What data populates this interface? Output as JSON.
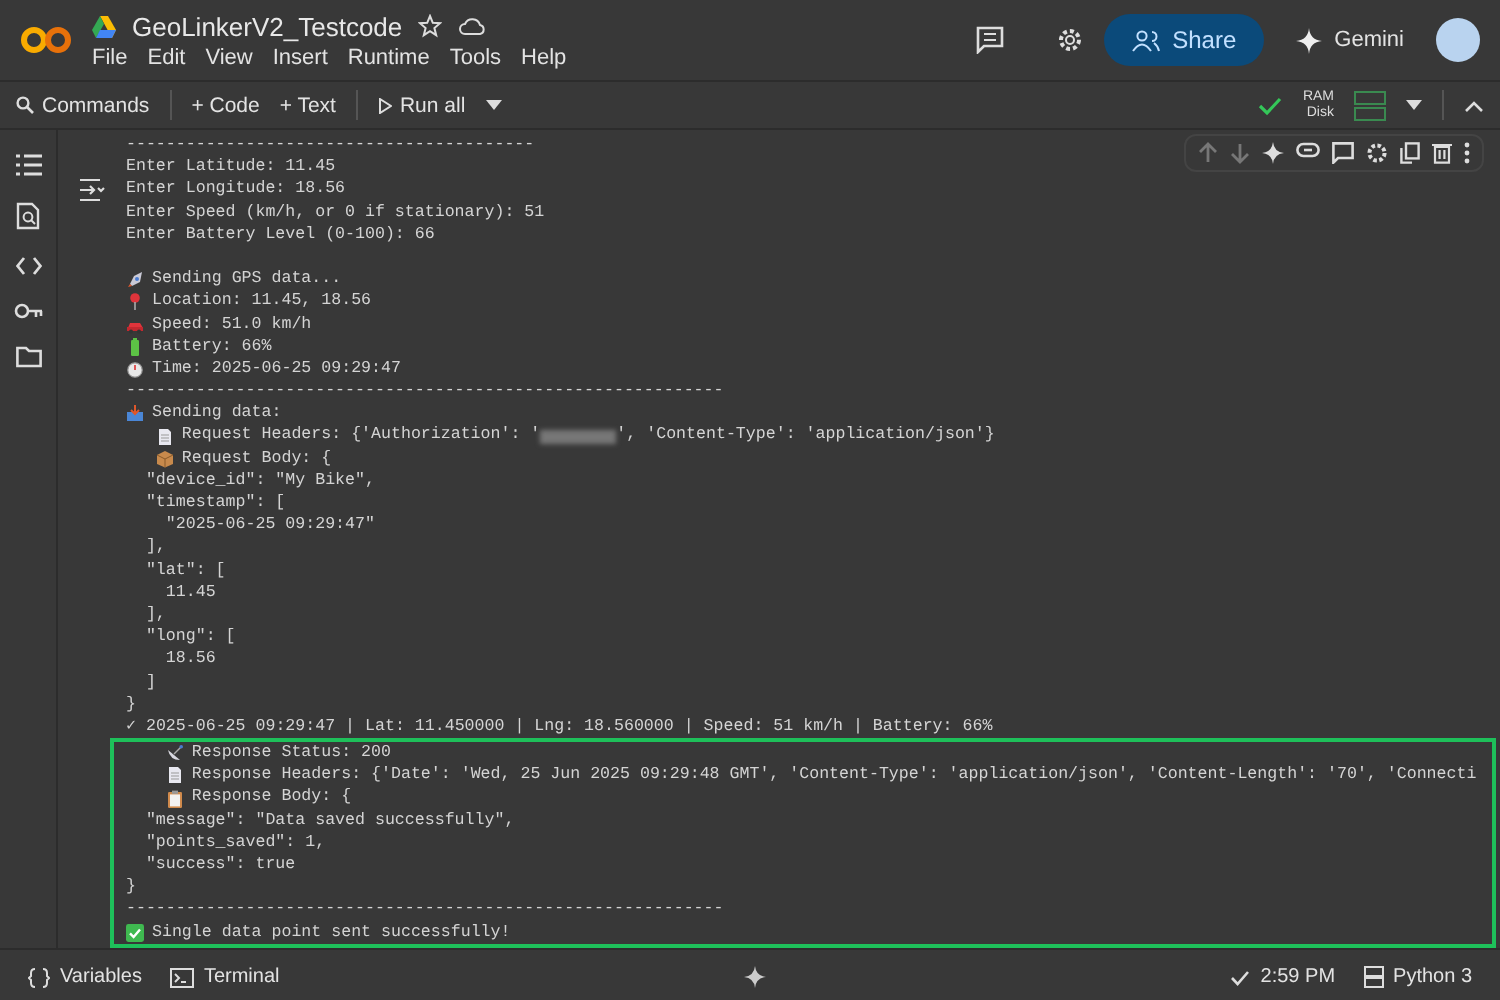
{
  "header": {
    "title": "GeoLinkerV2_Testcode",
    "menu": [
      "File",
      "Edit",
      "View",
      "Insert",
      "Runtime",
      "Tools",
      "Help"
    ],
    "share": "Share",
    "gemini": "Gemini"
  },
  "toolbar": {
    "commands": "Commands",
    "add_code": "+ Code",
    "add_text": "+ Text",
    "run_all": "Run all",
    "ram": "RAM",
    "disk": "Disk"
  },
  "output": {
    "lines": [
      {
        "kind": "text",
        "text": "-----------------------------------------"
      },
      {
        "kind": "text",
        "text": "Enter Latitude: 11.45"
      },
      {
        "kind": "text",
        "text": "Enter Longitude: 18.56"
      },
      {
        "kind": "text",
        "text": "Enter Speed (km/h, or 0 if stationary): 51"
      },
      {
        "kind": "text",
        "text": "Enter Battery Level (0-100): 66"
      },
      {
        "kind": "blank"
      },
      {
        "kind": "icon",
        "text": "Sending GPS data..."
      },
      {
        "kind": "icon",
        "text": "Location: 11.45, 18.56"
      },
      {
        "kind": "icon",
        "text": "Speed: 51.0 km/h"
      },
      {
        "kind": "icon",
        "text": "Battery: 66%"
      },
      {
        "kind": "icon",
        "text": "Time: 2025-06-25 09:29:47"
      },
      {
        "kind": "text",
        "text": "------------------------------------------------------------"
      },
      {
        "kind": "icon",
        "text": "Sending data:"
      },
      {
        "kind": "redacted",
        "text": "Request Headers: {'Authorization': '",
        "after": "', 'Content-Type': 'application/json'}"
      },
      {
        "kind": "nested-icon",
        "text": "Request Body: {"
      },
      {
        "kind": "text",
        "text": "  \"device_id\": \"My Bike\","
      },
      {
        "kind": "text",
        "text": "  \"timestamp\": ["
      },
      {
        "kind": "text",
        "text": "    \"2025-06-25 09:29:47\""
      },
      {
        "kind": "text",
        "text": "  ],"
      },
      {
        "kind": "text",
        "text": "  \"lat\": ["
      },
      {
        "kind": "text",
        "text": "    11.45"
      },
      {
        "kind": "text",
        "text": "  ],"
      },
      {
        "kind": "text",
        "text": "  \"long\": ["
      },
      {
        "kind": "text",
        "text": "    18.56"
      },
      {
        "kind": "text",
        "text": "  ]"
      },
      {
        "kind": "text",
        "text": "}"
      },
      {
        "kind": "text",
        "text": "✓ 2025-06-25 09:29:47 | Lat: 11.450000 | Lng: 18.560000 | Speed: 51 km/h | Battery: 66%"
      }
    ],
    "highlighted_lines": [
      {
        "kind": "nested-icon",
        "text": "Response Status: 200"
      },
      {
        "kind": "nested-icon",
        "text": "Response Headers: {'Date': 'Wed, 25 Jun 2025 09:29:48 GMT', 'Content-Type': 'application/json', 'Content-Length': '70', 'Connecti"
      },
      {
        "kind": "nested-icon",
        "text": "Response Body: {"
      },
      {
        "kind": "text",
        "text": "  \"message\": \"Data saved successfully\","
      },
      {
        "kind": "text",
        "text": "  \"points_saved\": 1,"
      },
      {
        "kind": "text",
        "text": "  \"success\": true"
      },
      {
        "kind": "text",
        "text": "}"
      },
      {
        "kind": "text",
        "text": "------------------------------------------------------------"
      },
      {
        "kind": "icon",
        "text": "Single data point sent successfully!"
      }
    ]
  },
  "status_bar": {
    "variables": "Variables",
    "terminal": "Terminal",
    "time": "2:59 PM",
    "runtime": "Python 3"
  }
}
